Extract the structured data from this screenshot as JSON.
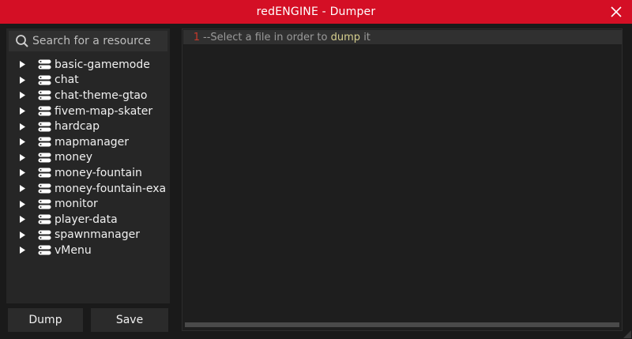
{
  "window": {
    "title": "redENGINE - Dumper"
  },
  "colors": {
    "title_bar": "#d40f25",
    "background": "#1a1a1a",
    "panel": "#262626",
    "line_number": "#c8392b",
    "keyword": "#d6cf8e"
  },
  "search": {
    "placeholder": "Search for a resource",
    "value": ""
  },
  "resources": [
    "basic-gamemode",
    "chat",
    "chat-theme-gtao",
    "fivem-map-skater",
    "hardcap",
    "mapmanager",
    "money",
    "money-fountain",
    "money-fountain-exa",
    "monitor",
    "player-data",
    "spawnmanager",
    "vMenu"
  ],
  "buttons": {
    "dump": "Dump",
    "save": "Save"
  },
  "editor": {
    "line_number": "1",
    "comment_prefix": "--Select a file in order to",
    "keyword": "dump",
    "comment_suffix": "it"
  },
  "icons": {
    "close": "close-icon",
    "search": "search-icon",
    "expand": "triangle-right-icon",
    "resource": "server-stack-icon"
  }
}
